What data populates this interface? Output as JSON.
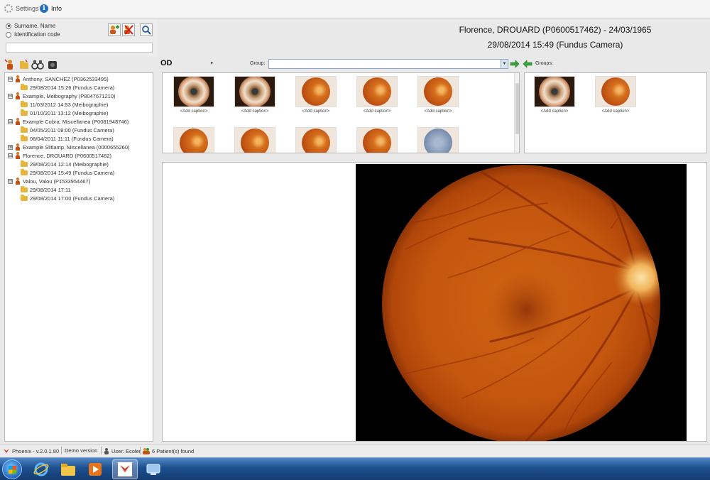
{
  "menu": {
    "settings_label": "Settings",
    "info_label": "Info"
  },
  "search": {
    "option_name": "Surname, Name",
    "option_code": "Identification code",
    "query": ""
  },
  "header": {
    "line1": "Florence, DROUARD (P0600517462) - 24/03/1965",
    "line2": "29/08/2014 15:49 (Fundus Camera)"
  },
  "tree": [
    {
      "type": "patient",
      "label": "Anthony, SANCHEZ (P0362533495)",
      "expander": "⊟"
    },
    {
      "type": "exam",
      "label": "29/08/2014 15:26 (Fundus Camera)"
    },
    {
      "type": "patient",
      "label": "Example, Meibography (P8047671210)",
      "expander": "⊟"
    },
    {
      "type": "exam",
      "label": "11/03/2012 14:53 (Meibographie)"
    },
    {
      "type": "exam",
      "label": "01/10/2011 13:12 (Meibographie)"
    },
    {
      "type": "patient",
      "label": "Example Cobra, Miscellanea (P0081948746)",
      "expander": "⊟"
    },
    {
      "type": "exam",
      "label": "04/05/2011 08:00 (Fundus Camera)"
    },
    {
      "type": "exam",
      "label": "08/04/2011 11:11 (Fundus Camera)"
    },
    {
      "type": "patient",
      "label": "Example Slitlamp, Miscellanea (0000655260)",
      "expander": "⊞"
    },
    {
      "type": "patient",
      "label": "Florence, DROUARD (P0600517462)",
      "expander": "⊟"
    },
    {
      "type": "exam",
      "label": "29/08/2014 12:14 (Meibographie)"
    },
    {
      "type": "exam",
      "label": "29/08/2014 15:49 (Fundus Camera)"
    },
    {
      "type": "patient",
      "label": "Valou, Valou (P1533954467)",
      "expander": "⊟"
    },
    {
      "type": "exam",
      "label": "29/08/2014 17:11"
    },
    {
      "type": "exam",
      "label": "29/08/2014 17:00 (Fundus Camera)"
    }
  ],
  "toolbar": {
    "eye_selected": "OD",
    "eye_caret": "▾",
    "group_label": "Group:",
    "groups_label": "Groups:"
  },
  "thumbnails": {
    "left": [
      {
        "kind": "ant",
        "caption": "<Add caption>"
      },
      {
        "kind": "ant",
        "caption": "<Add caption>"
      },
      {
        "kind": "fundus",
        "caption": "<Add caption>"
      },
      {
        "kind": "fundus",
        "caption": "<Add caption>"
      },
      {
        "kind": "fundus",
        "caption": "<Add caption>"
      },
      {
        "kind": "fundus",
        "caption": ""
      },
      {
        "kind": "fundus",
        "caption": ""
      },
      {
        "kind": "fundus",
        "caption": ""
      },
      {
        "kind": "fundus",
        "caption": ""
      },
      {
        "kind": "blue",
        "caption": ""
      }
    ],
    "right": [
      {
        "kind": "ant",
        "caption": "<Add caption>"
      },
      {
        "kind": "fundus",
        "caption": "<Add caption>"
      }
    ]
  },
  "status": {
    "app": "Phoenix - v.2.0.1.80",
    "mode": "Demo version",
    "user": "User: Ecoler",
    "found": "6 Patient(s) found"
  },
  "taskbar": [
    "internet-explorer",
    "file-explorer",
    "media-player",
    "phoenix-app",
    "network-app"
  ],
  "colors": {
    "accent": "#2b6fbf",
    "fundus": "#c8560f"
  }
}
